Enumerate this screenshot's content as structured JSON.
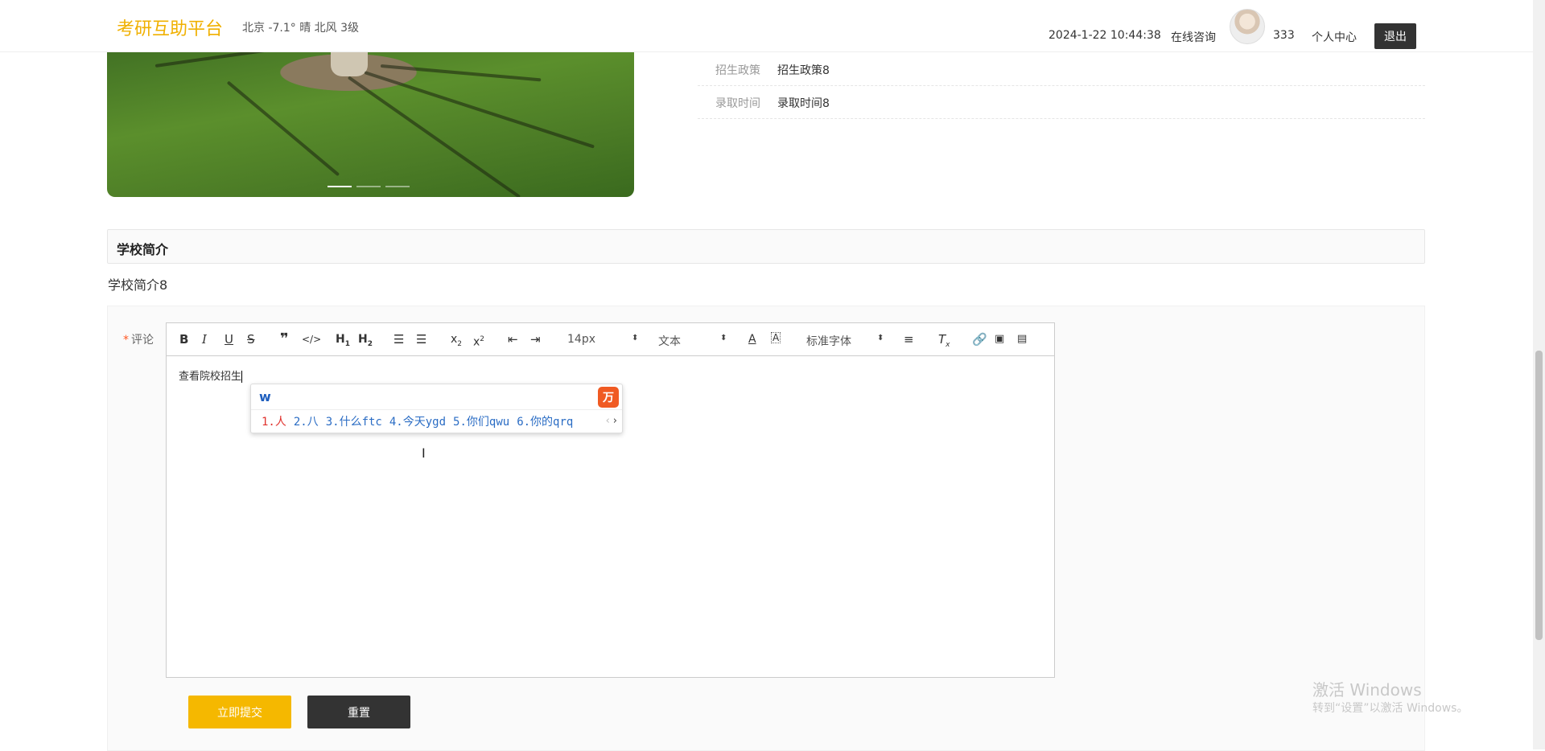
{
  "header": {
    "brand": "考研互助平台",
    "weather": "北京  -7.1°  晴  北风  3级",
    "datetime": "2024-1-22 10:44:38",
    "consult": "在线咨询",
    "username": "333",
    "personal_center": "个人中心",
    "logout": "退出",
    "brand_color": "#f0b000"
  },
  "info": [
    {
      "key": "招生政策",
      "value": "招生政策8"
    },
    {
      "key": "录取时间",
      "value": "录取时间8"
    }
  ],
  "intro": {
    "title": "学校简介",
    "text": "学校简介8"
  },
  "form": {
    "required_mark": "*",
    "label": "评论",
    "toolbar": {
      "font_size": "14px",
      "block_type": "文本",
      "font_family": "标准字体"
    },
    "content": "查看院校招生",
    "submit": "立即提交",
    "reset": "重置"
  },
  "ime": {
    "input": "w",
    "logo": "万",
    "candidates": [
      "1.人",
      "2.八",
      "3.什么ftc",
      "4.今天ygd",
      "5.你们qwu",
      "6.你的qrq"
    ]
  },
  "watermark": {
    "line1": "激活 Windows",
    "line2": "转到“设置”以激活 Windows。"
  }
}
